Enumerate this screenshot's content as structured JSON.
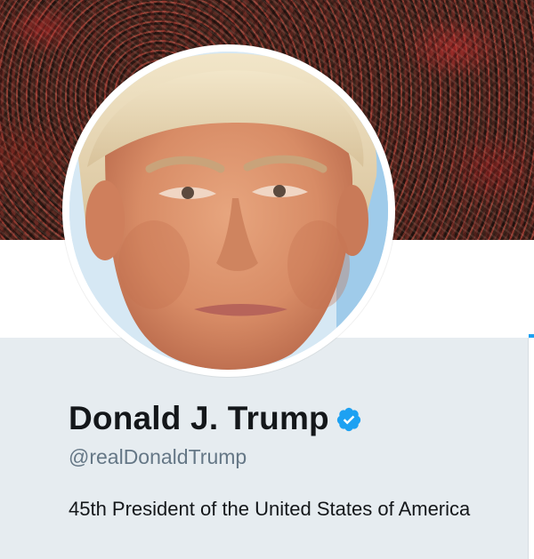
{
  "profile": {
    "display_name": "Donald J. Trump",
    "handle": "@realDonaldTrump",
    "bio": "45th President of the United States of America",
    "verified": true
  },
  "icons": {
    "verified_badge": "verified-badge-icon"
  },
  "colors": {
    "accent": "#1da1f2",
    "name_text": "#14171a",
    "handle_text": "#657786",
    "card_background": "#e6ecf0"
  }
}
